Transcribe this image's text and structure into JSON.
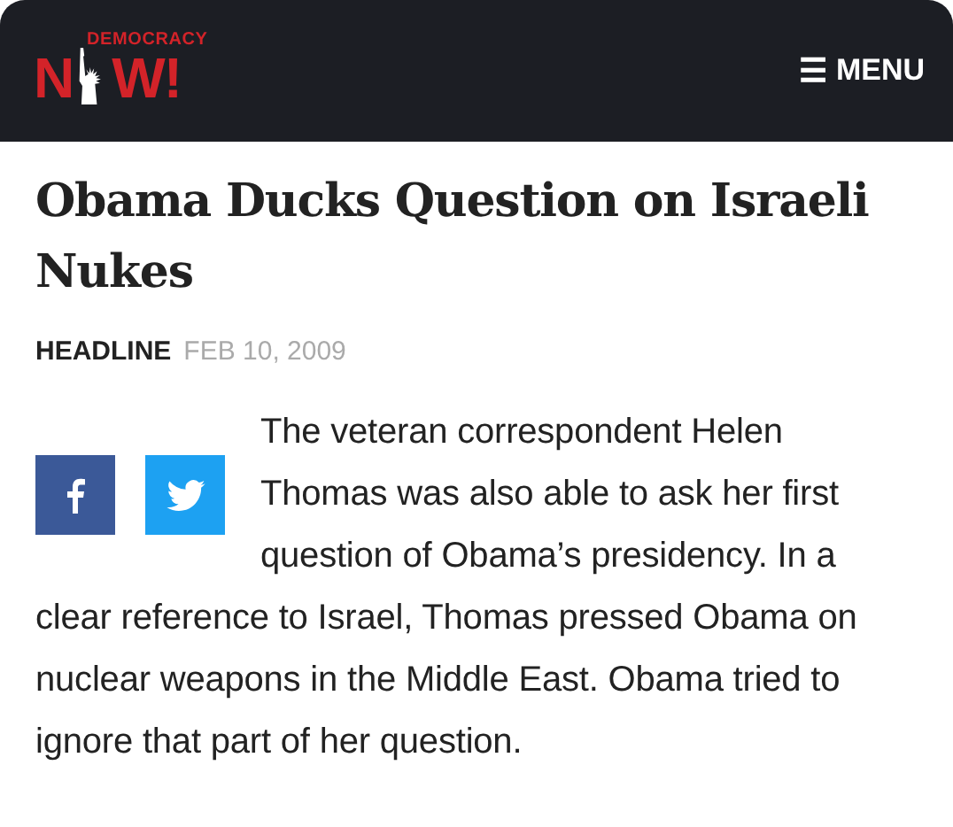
{
  "header": {
    "logo": {
      "top": "DEMOCRACY",
      "left": "N",
      "right": "W!"
    },
    "menu": {
      "icon": "☰",
      "label": "MENU"
    }
  },
  "article": {
    "title": "Obama Ducks Question on Israeli Nukes",
    "category": "HEADLINE",
    "date": "FEB 10, 2009",
    "share": [
      {
        "kind": "facebook"
      },
      {
        "kind": "twitter"
      }
    ],
    "body": [
      "The veteran correspondent Helen Thomas was also able to ask her first question of Obama’s presidency. In a",
      "clear reference to Israel, Thomas pressed Obama on nuclear weapons in the Middle East. Obama tried to ignore that part of her question."
    ]
  }
}
